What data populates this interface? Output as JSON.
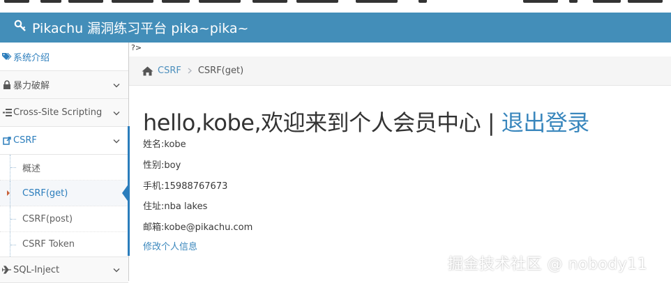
{
  "brand": {
    "title": "Pikachu 漏洞练习平台 pika~pika~",
    "icon": "key-icon"
  },
  "sidebar": {
    "items": [
      {
        "label": "系统介绍",
        "icon": "tags-icon"
      },
      {
        "label": "暴力破解",
        "icon": "lock-icon"
      },
      {
        "label": "Cross-Site Scripting",
        "icon": "list-icon"
      },
      {
        "label": "CSRF",
        "icon": "external-link-icon"
      },
      {
        "label": "SQL-Inject",
        "icon": "plane-icon"
      }
    ],
    "csrf_sub": [
      {
        "label": "概述"
      },
      {
        "label": "CSRF(get)"
      },
      {
        "label": "CSRF(post)"
      },
      {
        "label": "CSRF Token"
      }
    ]
  },
  "main": {
    "stray_text": "?>",
    "breadcrumb": {
      "home_icon": "home-icon",
      "link": "CSRF",
      "current": "CSRF(get)"
    },
    "greeting": {
      "text": "hello,kobe,欢迎来到个人会员中心 | ",
      "logout": "退出登录"
    },
    "info": [
      "姓名:kobe",
      "性别:boy",
      "手机:15988767673",
      "住址:nba lakes",
      "邮箱:kobe@pikachu.com"
    ],
    "edit_link": "修改个人信息"
  },
  "watermark": "掘金技术社区 @ nobody11",
  "colors": {
    "navbar": "#438eb9",
    "link": "#4c8fbd",
    "active": "#2b7dbc"
  }
}
